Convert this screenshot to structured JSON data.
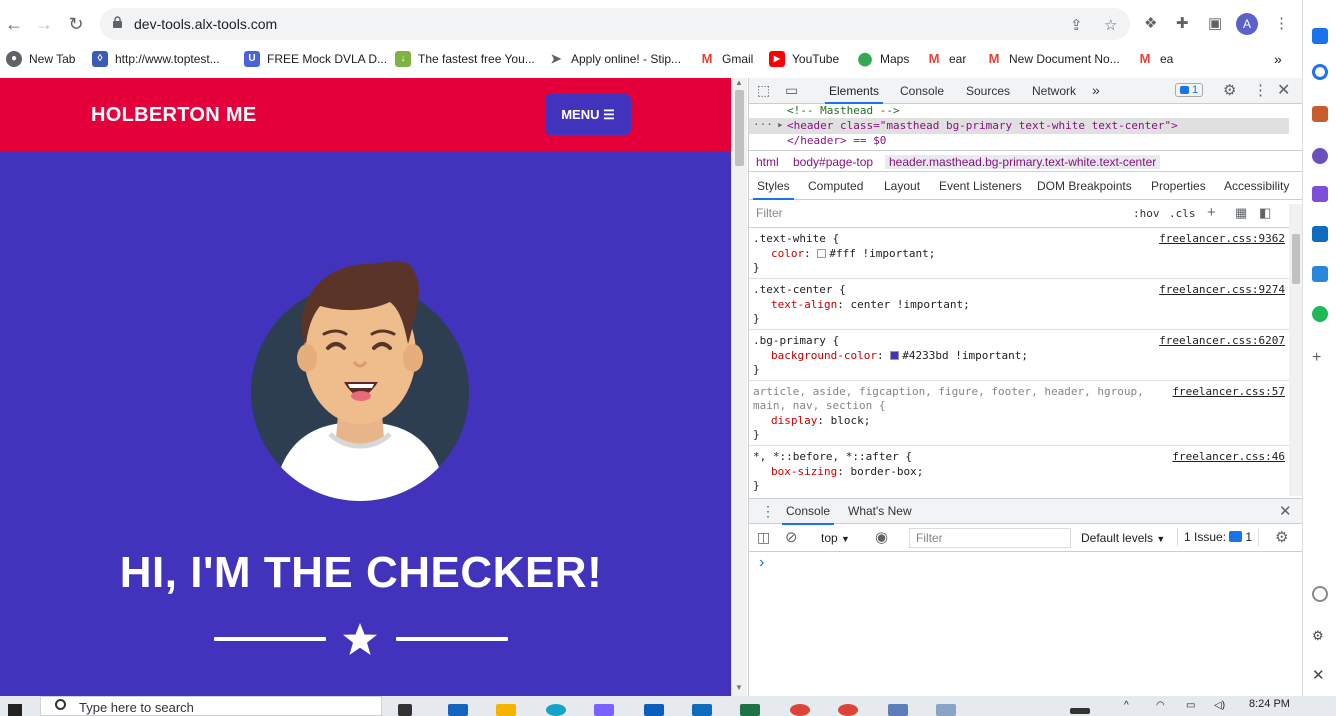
{
  "browser": {
    "url": "dev-tools.alx-tools.com",
    "profile_initial": "A",
    "bookmarks": [
      {
        "label": "New Tab",
        "icon": "globe-icon",
        "color": "#5f6368"
      },
      {
        "label": "http://www.toptest...",
        "icon": "page-icon",
        "color": "#3b5bb6"
      },
      {
        "label": "FREE Mock DVLA D...",
        "icon": "shield-icon",
        "color": "#4a63d8"
      },
      {
        "label": "The fastest free You...",
        "icon": "download-icon",
        "color": "#7cb342"
      },
      {
        "label": "Apply online! - Stip...",
        "icon": "send-icon",
        "color": "#5f6368"
      },
      {
        "label": "Gmail",
        "icon": "gmail-icon",
        "color": "#ea4335"
      },
      {
        "label": "YouTube",
        "icon": "youtube-icon",
        "color": "#ff0000"
      },
      {
        "label": "Maps",
        "icon": "maps-icon",
        "color": "#34a853"
      },
      {
        "label": "ear",
        "icon": "gmail-icon",
        "color": "#ea4335"
      },
      {
        "label": "New Document No...",
        "icon": "gmail-icon",
        "color": "#ea4335"
      },
      {
        "label": "ea",
        "icon": "gmail-icon",
        "color": "#ea4335"
      }
    ],
    "more_bookmarks": "»"
  },
  "site": {
    "brand": "HOLBERTON ME",
    "menu_label": "MENU ☰",
    "heading": "HI, I'M THE CHECKER!",
    "colors": {
      "navbar": "#e4003b",
      "primary": "#4233bd"
    }
  },
  "devtools": {
    "tabs": [
      "Elements",
      "Console",
      "Sources",
      "Network"
    ],
    "more_tabs": "»",
    "issues_count": "1",
    "dom": {
      "comment": "<!-- Masthead -->",
      "header_open": "<header class=\"masthead bg-primary text-white text-center\">",
      "header_close": "</header> == $0",
      "ellipsis": "···"
    },
    "breadcrumbs": [
      "html",
      "body#page-top",
      "header.masthead.bg-primary.text-white.text-center"
    ],
    "sub_tabs": [
      "Styles",
      "Computed",
      "Layout",
      "Event Listeners",
      "DOM Breakpoints",
      "Properties",
      "Accessibility"
    ],
    "filter_placeholder": "Filter",
    "hov": ":hov",
    "cls": ".cls",
    "rules": [
      {
        "selector": ".text-white {",
        "source": "freelancer.css:9362",
        "props": [
          {
            "name": "color",
            "value": "#fff !important;",
            "swatch": "#ffffff"
          }
        ]
      },
      {
        "selector": ".text-center {",
        "source": "freelancer.css:9274",
        "props": [
          {
            "name": "text-align",
            "value": "center !important;"
          }
        ]
      },
      {
        "selector": ".bg-primary {",
        "source": "freelancer.css:6207",
        "props": [
          {
            "name": "background-color",
            "value": "#4233bd !important;",
            "swatch": "#4233bd"
          }
        ]
      },
      {
        "selector": "article, aside, figcaption, figure, footer, header, hgroup,",
        "selector2": "main, nav, section {",
        "source": "freelancer.css:57",
        "props": [
          {
            "name": "display",
            "value": "block;"
          }
        ]
      },
      {
        "selector": "*, *::before, *::after {",
        "source": "freelancer.css:46",
        "props": [
          {
            "name": "box-sizing",
            "value": "border-box;"
          }
        ]
      }
    ],
    "closing_brace": "}",
    "drawer_tabs": [
      "Console",
      "What's New"
    ],
    "console": {
      "context": "top",
      "filter_placeholder": "Filter",
      "levels": "Default levels",
      "issues_label": "1 Issue:",
      "issues_count": "1",
      "prompt": "›"
    }
  },
  "taskbar": {
    "search_placeholder": "Type here to search",
    "time": "8:24 PM"
  }
}
